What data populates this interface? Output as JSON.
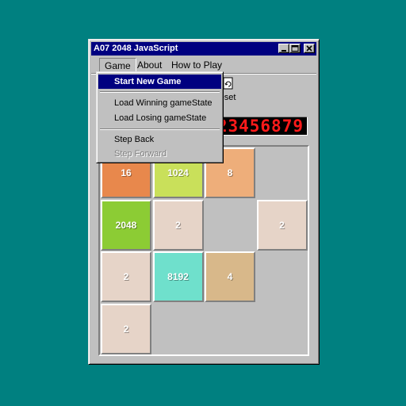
{
  "window": {
    "title": "A07 2048 JavaScript"
  },
  "menubar": {
    "items": [
      {
        "label": "Game"
      },
      {
        "label": "About"
      },
      {
        "label": "How to Play"
      }
    ]
  },
  "toolbar": {
    "reset_label": "eset"
  },
  "counter": {
    "value": "123456879"
  },
  "game_menu": {
    "items": [
      {
        "label": "Start New Game",
        "state": "highlighted"
      },
      {
        "label": "Load Winning gameState",
        "state": "enabled"
      },
      {
        "label": "Load Losing gameState",
        "state": "enabled"
      },
      {
        "label": "Step Back",
        "state": "enabled"
      },
      {
        "label": "Step Forward",
        "state": "disabled"
      }
    ]
  },
  "board": {
    "tiles": [
      {
        "value": "16",
        "color": "#e8884c"
      },
      {
        "value": "1024",
        "color": "#c9e05a"
      },
      {
        "value": "8",
        "color": "#eeae7a"
      },
      {
        "value": "",
        "color": ""
      },
      {
        "value": "2048",
        "color": "#8ccc34"
      },
      {
        "value": "2",
        "color": "#e6d4c8"
      },
      {
        "value": "",
        "color": ""
      },
      {
        "value": "2",
        "color": "#e6d4c8"
      },
      {
        "value": "2",
        "color": "#e6d4c8"
      },
      {
        "value": "8192",
        "color": "#6fe0cc"
      },
      {
        "value": "4",
        "color": "#d8b88a"
      },
      {
        "value": "",
        "color": ""
      },
      {
        "value": "2",
        "color": "#e6d4c8"
      },
      {
        "value": "",
        "color": ""
      },
      {
        "value": "",
        "color": ""
      },
      {
        "value": "",
        "color": ""
      }
    ]
  }
}
